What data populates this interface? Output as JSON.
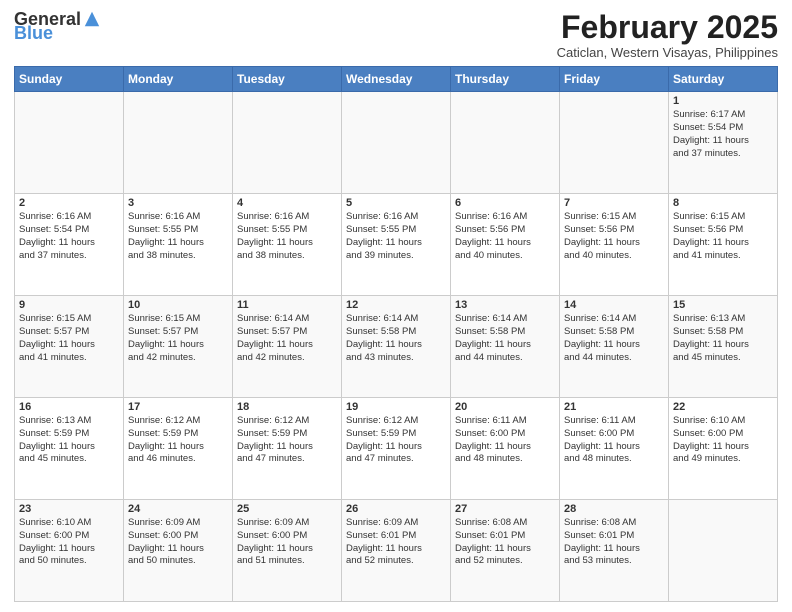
{
  "header": {
    "logo_general": "General",
    "logo_blue": "Blue",
    "month_year": "February 2025",
    "location": "Caticlan, Western Visayas, Philippines"
  },
  "weekdays": [
    "Sunday",
    "Monday",
    "Tuesday",
    "Wednesday",
    "Thursday",
    "Friday",
    "Saturday"
  ],
  "weeks": [
    [
      {
        "day": "",
        "info": ""
      },
      {
        "day": "",
        "info": ""
      },
      {
        "day": "",
        "info": ""
      },
      {
        "day": "",
        "info": ""
      },
      {
        "day": "",
        "info": ""
      },
      {
        "day": "",
        "info": ""
      },
      {
        "day": "1",
        "info": "Sunrise: 6:17 AM\nSunset: 5:54 PM\nDaylight: 11 hours\nand 37 minutes."
      }
    ],
    [
      {
        "day": "2",
        "info": "Sunrise: 6:16 AM\nSunset: 5:54 PM\nDaylight: 11 hours\nand 37 minutes."
      },
      {
        "day": "3",
        "info": "Sunrise: 6:16 AM\nSunset: 5:55 PM\nDaylight: 11 hours\nand 38 minutes."
      },
      {
        "day": "4",
        "info": "Sunrise: 6:16 AM\nSunset: 5:55 PM\nDaylight: 11 hours\nand 38 minutes."
      },
      {
        "day": "5",
        "info": "Sunrise: 6:16 AM\nSunset: 5:55 PM\nDaylight: 11 hours\nand 39 minutes."
      },
      {
        "day": "6",
        "info": "Sunrise: 6:16 AM\nSunset: 5:56 PM\nDaylight: 11 hours\nand 40 minutes."
      },
      {
        "day": "7",
        "info": "Sunrise: 6:15 AM\nSunset: 5:56 PM\nDaylight: 11 hours\nand 40 minutes."
      },
      {
        "day": "8",
        "info": "Sunrise: 6:15 AM\nSunset: 5:56 PM\nDaylight: 11 hours\nand 41 minutes."
      }
    ],
    [
      {
        "day": "9",
        "info": "Sunrise: 6:15 AM\nSunset: 5:57 PM\nDaylight: 11 hours\nand 41 minutes."
      },
      {
        "day": "10",
        "info": "Sunrise: 6:15 AM\nSunset: 5:57 PM\nDaylight: 11 hours\nand 42 minutes."
      },
      {
        "day": "11",
        "info": "Sunrise: 6:14 AM\nSunset: 5:57 PM\nDaylight: 11 hours\nand 42 minutes."
      },
      {
        "day": "12",
        "info": "Sunrise: 6:14 AM\nSunset: 5:58 PM\nDaylight: 11 hours\nand 43 minutes."
      },
      {
        "day": "13",
        "info": "Sunrise: 6:14 AM\nSunset: 5:58 PM\nDaylight: 11 hours\nand 44 minutes."
      },
      {
        "day": "14",
        "info": "Sunrise: 6:14 AM\nSunset: 5:58 PM\nDaylight: 11 hours\nand 44 minutes."
      },
      {
        "day": "15",
        "info": "Sunrise: 6:13 AM\nSunset: 5:58 PM\nDaylight: 11 hours\nand 45 minutes."
      }
    ],
    [
      {
        "day": "16",
        "info": "Sunrise: 6:13 AM\nSunset: 5:59 PM\nDaylight: 11 hours\nand 45 minutes."
      },
      {
        "day": "17",
        "info": "Sunrise: 6:12 AM\nSunset: 5:59 PM\nDaylight: 11 hours\nand 46 minutes."
      },
      {
        "day": "18",
        "info": "Sunrise: 6:12 AM\nSunset: 5:59 PM\nDaylight: 11 hours\nand 47 minutes."
      },
      {
        "day": "19",
        "info": "Sunrise: 6:12 AM\nSunset: 5:59 PM\nDaylight: 11 hours\nand 47 minutes."
      },
      {
        "day": "20",
        "info": "Sunrise: 6:11 AM\nSunset: 6:00 PM\nDaylight: 11 hours\nand 48 minutes."
      },
      {
        "day": "21",
        "info": "Sunrise: 6:11 AM\nSunset: 6:00 PM\nDaylight: 11 hours\nand 48 minutes."
      },
      {
        "day": "22",
        "info": "Sunrise: 6:10 AM\nSunset: 6:00 PM\nDaylight: 11 hours\nand 49 minutes."
      }
    ],
    [
      {
        "day": "23",
        "info": "Sunrise: 6:10 AM\nSunset: 6:00 PM\nDaylight: 11 hours\nand 50 minutes."
      },
      {
        "day": "24",
        "info": "Sunrise: 6:09 AM\nSunset: 6:00 PM\nDaylight: 11 hours\nand 50 minutes."
      },
      {
        "day": "25",
        "info": "Sunrise: 6:09 AM\nSunset: 6:00 PM\nDaylight: 11 hours\nand 51 minutes."
      },
      {
        "day": "26",
        "info": "Sunrise: 6:09 AM\nSunset: 6:01 PM\nDaylight: 11 hours\nand 52 minutes."
      },
      {
        "day": "27",
        "info": "Sunrise: 6:08 AM\nSunset: 6:01 PM\nDaylight: 11 hours\nand 52 minutes."
      },
      {
        "day": "28",
        "info": "Sunrise: 6:08 AM\nSunset: 6:01 PM\nDaylight: 11 hours\nand 53 minutes."
      },
      {
        "day": "",
        "info": ""
      }
    ]
  ]
}
